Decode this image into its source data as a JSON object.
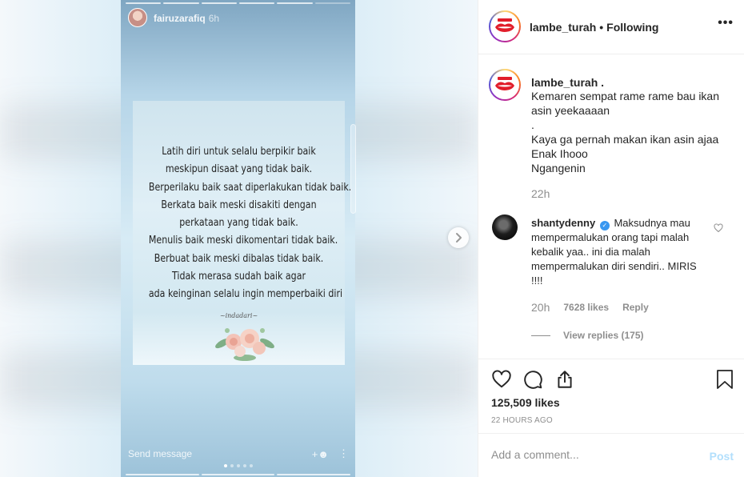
{
  "story": {
    "username": "fairuzarafiq",
    "time": "6h",
    "quote_lines": [
      "Latih diri untuk selalu berpikir baik",
      "meskipun disaat yang tidak baik.",
      "Berperilaku baik saat diperlakukan tidak baik.",
      "Berkata baik meski disakiti dengan",
      "perkataan yang tidak baik.",
      "Menulis baik meski dikomentari tidak baik.",
      "Berbuat baik meski dibalas tidak baik.",
      "Tidak merasa sudah baik agar",
      "ada keinginan selalu ingin memperbaiki diri"
    ],
    "signature": "~indadari~",
    "send_message": "Send message",
    "icons": {
      "add_friend": "add-friend-icon",
      "more": "more-vertical-icon"
    }
  },
  "header": {
    "username": "lambe_turah",
    "separator": "•",
    "follow_status": "Following",
    "more": "•••"
  },
  "caption": {
    "username": "lambe_turah .",
    "lines": [
      "Kemaren sempat rame rame bau ikan asin yeekaaaan",
      ".",
      "Kaya ga pernah makan ikan asin ajaa",
      "Enak Ihooo",
      "Ngangenin"
    ],
    "time": "22h"
  },
  "comment": {
    "username": "shantydenny",
    "text": "Maksudnya mau mempermalukan orang tapi malah kebalik yaa.. ini dia malah mempermalukan diri sendiri.. MIRIS !!!!",
    "time": "20h",
    "likes": "7628 likes",
    "reply": "Reply",
    "view_replies": "View replies (175)"
  },
  "post": {
    "likes": "125,509 likes",
    "time": "22 HOURS AGO"
  },
  "add_comment": {
    "placeholder": "Add a comment...",
    "post_label": "Post"
  },
  "colors": {
    "accent": "#3897f0",
    "post_disabled": "#b2dffc",
    "muted": "#8e8e8e"
  }
}
